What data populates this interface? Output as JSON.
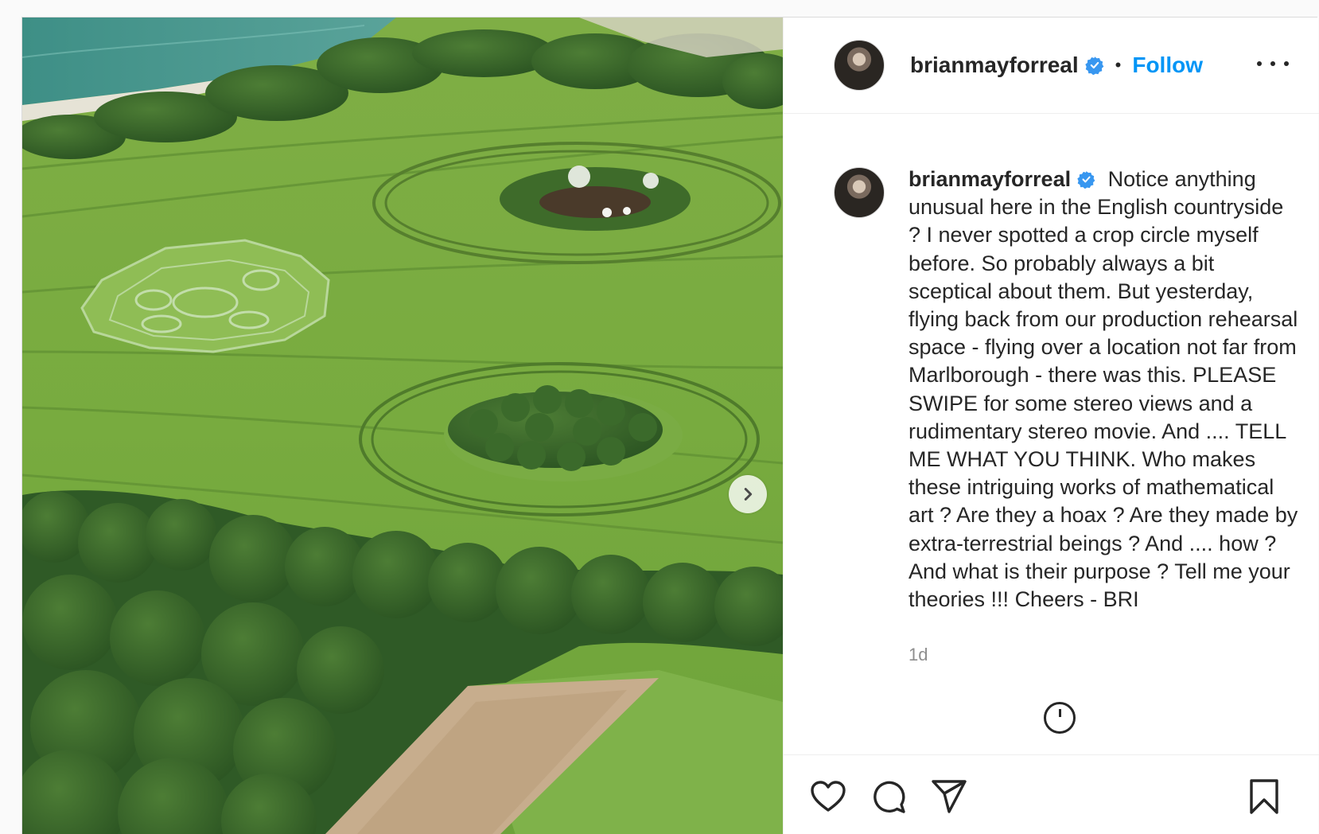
{
  "post": {
    "username": "brianmayforreal",
    "verified": true,
    "follow_label": "Follow",
    "separator": "•",
    "caption": "Notice anything unusual here in the English countryside ? I never spotted a crop circle myself before. So probably always a bit sceptical about them. But yesterday, flying back from our production rehearsal space - flying over a location not far from Marlborough - there was this. PLEASE SWIPE for some stereo views and a rudimentary stereo movie. And .... TELL ME WHAT YOU THINK. Who makes these intriguing works of mathematical art ? Are they a hoax ? Are they made by extra-terrestrial beings ? And .... how ? And what is their purpose ? Tell me your theories !!! Cheers - BRI",
    "timestamp": "1d"
  },
  "icons": {
    "verified": "verified-badge-icon",
    "more": "more-options-icon",
    "next": "chevron-right-icon",
    "like": "heart-icon",
    "comment": "comment-icon",
    "share": "paper-plane-icon",
    "save": "bookmark-icon",
    "load_more": "plus-circle-icon"
  },
  "colors": {
    "accent": "#0095f6",
    "text": "#262626",
    "muted": "#8e8e8e"
  }
}
